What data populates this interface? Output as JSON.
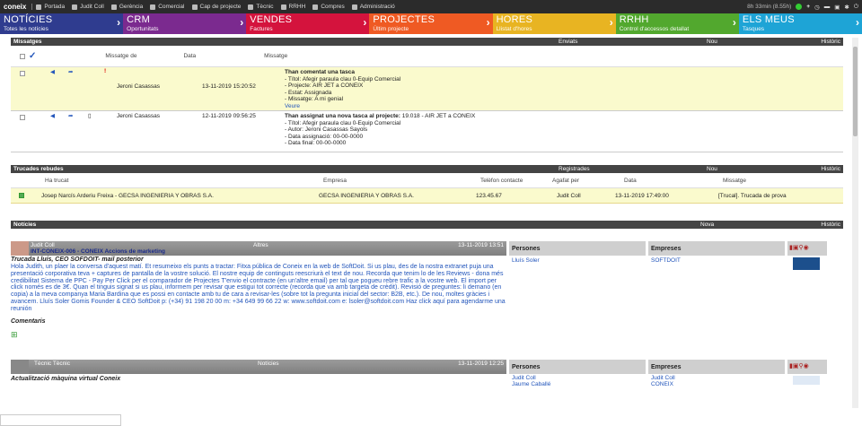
{
  "topbar": {
    "brand": "coneix",
    "items": [
      "Portada",
      "Judit Coll",
      "Gerència",
      "Comercial",
      "Cap de projecte",
      "Tècnic",
      "RRHH",
      "Compres",
      "Administració"
    ],
    "session": "8h 33min (8.55h)"
  },
  "modules": [
    {
      "title": "NOTÍCIES",
      "sub": "Totes les notícies",
      "color": "#2f3c8f"
    },
    {
      "title": "CRM",
      "sub": "Oportunitats",
      "color": "#7b2a8f"
    },
    {
      "title": "VENDES",
      "sub": "Factures",
      "color": "#d4133d"
    },
    {
      "title": "PROJECTES",
      "sub": "Últim projecte",
      "color": "#ef5a23"
    },
    {
      "title": "HORES",
      "sub": "Llistat d'hores",
      "color": "#e8b422"
    },
    {
      "title": "RRHH",
      "sub": "Control d'accessos detallat",
      "color": "#52a82e"
    },
    {
      "title": "ELS MEUS",
      "sub": "Tasques",
      "color": "#1ea4d6"
    }
  ],
  "missatges": {
    "title": "Missatges",
    "enviats": "Enviats",
    "nou": "Nou",
    "historic": "Històric",
    "cols": [
      "Missatge de",
      "Data",
      "Missatge"
    ],
    "rows": [
      {
        "from": "Jeroni Casassas",
        "date": "13-11-2019 15:20:52",
        "head": "Than comentat una tasca",
        "lines": [
          "- Títol: Afegir paraula clau 0-Equip Comercial",
          "- Projecte: AIR JET a CONEIX",
          "- Estat: Assignada",
          "- Missatge: A mi genial"
        ],
        "link": "Veure"
      },
      {
        "from": "Jeroni Casassas",
        "date": "12-11-2019 09:56:25",
        "head": "Than assignat una nova tasca al projecte:",
        "headtail": " 19.018 - AIR JET a CONEIX",
        "lines": [
          "- Títol: Afegir paraula clau 0-Equip Comercial",
          "- Autor: Jeroni Casassas Sayols",
          "- Data assignació: 00-00-0000",
          "- Data final: 00-00-0000"
        ]
      }
    ]
  },
  "trucades": {
    "title": "Trucades rebudes",
    "registrades": "Registrades",
    "nou": "Nou",
    "historic": "Històric",
    "cols": [
      "Ha trucat",
      "Empresa",
      "Telèfon contacte",
      "Agafat per",
      "Data",
      "Missatge"
    ],
    "row": {
      "who": "Josep Narcís Arderiu Freixa - GECSA INGENIERIA Y OBRAS S.A.",
      "empresa": "GECSA INGENIERIA Y OBRAS S.A.",
      "tel": "123.45.67",
      "agafat": "Judit Coll",
      "data": "13-11-2019 17:49:00",
      "msg": "[Trucal]. Trucada de prova"
    }
  },
  "noticies": {
    "title": "Notícies",
    "nova": "Nova",
    "historic": "Històric",
    "items": [
      {
        "author": "Judit Coll",
        "cat": "Altres",
        "date": "13-11-2019 13:51",
        "subject": "INT-CONEIX-006 - CONEIX Accions de marketing",
        "title": "Trucada Lluís, CEO SOFDOIT- mail posterior",
        "body": "Hola Judith,  un plaer la conversa d'aquest matí. Et resumeixo els punts a tractar:   Fitxa pública de Coneix en la web de SoftDoit. Si us plau, des de la nostra extranet puja una presentació corporativa teva + captures de pantalla de la vostre solució. El nostre equip de continguts reescriurà el text de nou.  Recorda que tenim lo de les Reviews - dona més credibilitat Sistema de PPC - Pay Per Click per el comparador de Projectes T'envio el contracte (en un'altre email) per tal que pogueu rebre trafic a la vostre web. El import per click només es de 3€. Quan el tinguis signat si us plau, informem per revisar que estigui tot correcte (recorda que va amb targeta de crèdit).  Revisió de preguntes: li demano (en copia) a la meva companya Maria Bardina que es possi en contacte amb tu de cara a revisar-les (sobre tot la pregunta inicial del sector: B2B, etc.). De nou, moltes gràcies i avancem.   Lluís Soler Gomis Founder & CEO SoftDoit p: (+34) 91 198 20 00  m: +34 649 99 66 22 w: www.softdoit.com  e: lsoler@softdoit.com Haz click aquí para agendarme una reunión",
        "comentaris": "Comentaris",
        "persones_h": "Persones",
        "persones": [
          "Lluís Soler"
        ],
        "empreses_h": "Empreses",
        "empreses": [
          "SOFTDOIT"
        ]
      },
      {
        "author": "Tècnic Tècnic",
        "cat": "Notícies",
        "date": "13-11-2019 12:25",
        "subject": "",
        "title": "Actualització màquina virtual Coneix",
        "persones_h": "Persones",
        "persones": [
          "Judit Coll",
          "Jaume Caballé"
        ],
        "empreses_h": "Empreses",
        "empreses": [
          "Judit Coll",
          "CONEIX"
        ]
      }
    ]
  }
}
